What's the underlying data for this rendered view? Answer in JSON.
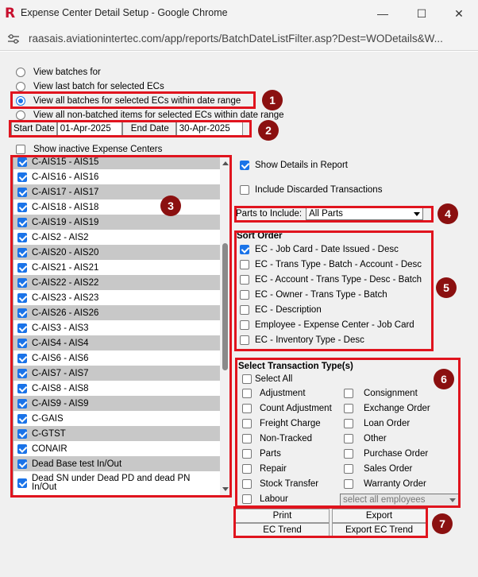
{
  "window": {
    "title": "Expense Center Detail Setup - Google Chrome",
    "url": "raasais.aviationintertec.com/app/reports/BatchDateListFilter.asp?Dest=WODetails&W...",
    "app_icon_letter": "R",
    "minimize_glyph": "—",
    "maximize_glyph": "☐",
    "close_glyph": "✕"
  },
  "batch_options": [
    {
      "label": "View batches for",
      "selected": false
    },
    {
      "label": "View last batch for selected ECs",
      "selected": false
    },
    {
      "label": "View all batches for selected ECs within date range",
      "selected": true
    },
    {
      "label": "View all non-batched items for selected ECs within date range",
      "selected": false
    }
  ],
  "date_range": {
    "start_label": "Start Date",
    "start_value": "01-Apr-2025",
    "end_label": "End Date",
    "end_value": "30-Apr-2025"
  },
  "show_inactive": {
    "label": "Show inactive Expense Centers",
    "checked": false
  },
  "expense_centers": [
    {
      "label": "C-AIS15 - AIS15",
      "checked": true
    },
    {
      "label": "C-AIS16 - AIS16",
      "checked": true
    },
    {
      "label": "C-AIS17 - AIS17",
      "checked": true
    },
    {
      "label": "C-AIS18 - AIS18",
      "checked": true
    },
    {
      "label": "C-AIS19 - AIS19",
      "checked": true
    },
    {
      "label": "C-AIS2 - AIS2",
      "checked": true
    },
    {
      "label": "C-AIS20 - AIS20",
      "checked": true
    },
    {
      "label": "C-AIS21 - AIS21",
      "checked": true
    },
    {
      "label": "C-AIS22 - AIS22",
      "checked": true
    },
    {
      "label": "C-AIS23 - AIS23",
      "checked": true
    },
    {
      "label": "C-AIS26 - AIS26",
      "checked": true
    },
    {
      "label": "C-AIS3 - AIS3",
      "checked": true
    },
    {
      "label": "C-AIS4 - AIS4",
      "checked": true
    },
    {
      "label": "C-AIS6 - AIS6",
      "checked": true
    },
    {
      "label": "C-AIS7 - AIS7",
      "checked": true
    },
    {
      "label": "C-AIS8 - AIS8",
      "checked": true
    },
    {
      "label": "C-AIS9 - AIS9",
      "checked": true
    },
    {
      "label": "C-GAIS",
      "checked": true
    },
    {
      "label": "C-GTST",
      "checked": true
    },
    {
      "label": "CONAIR",
      "checked": true
    },
    {
      "label": "Dead Base test In/Out",
      "checked": true
    },
    {
      "label": "Dead SN under Dead PD and dead PN In/Out",
      "checked": true
    }
  ],
  "options": {
    "show_details": {
      "label": "Show Details in Report",
      "checked": true
    },
    "include_discarded": {
      "label": "Include Discarded Transactions",
      "checked": false
    }
  },
  "parts": {
    "label": "Parts to Include:",
    "value": "All Parts"
  },
  "sort_order": {
    "title": "Sort Order",
    "items": [
      {
        "label": "EC - Job Card - Date Issued - Desc",
        "checked": true
      },
      {
        "label": "EC - Trans Type - Batch - Account - Desc",
        "checked": false
      },
      {
        "label": "EC - Account - Trans Type - Desc - Batch",
        "checked": false
      },
      {
        "label": "EC - Owner - Trans Type - Batch",
        "checked": false
      },
      {
        "label": "EC - Description",
        "checked": false
      },
      {
        "label": "Employee - Expense Center - Job Card",
        "checked": false
      },
      {
        "label": "EC - Inventory Type - Desc",
        "checked": false
      }
    ]
  },
  "transaction_types": {
    "title": "Select Transaction Type(s)",
    "select_all": "Select All",
    "left": [
      "Adjustment",
      "Count Adjustment",
      "Freight Charge",
      "Non-Tracked",
      "Parts",
      "Repair",
      "Stock Transfer",
      "Labour"
    ],
    "right": [
      "Consignment",
      "Exchange Order",
      "Loan Order",
      "Other",
      "Purchase Order",
      "Sales Order",
      "Warranty Order"
    ],
    "employee_select": "select all employees"
  },
  "buttons": {
    "print": "Print",
    "export": "Export",
    "ec_trend": "EC Trend",
    "export_ec_trend": "Export EC Trend"
  },
  "badges": [
    "1",
    "2",
    "3",
    "4",
    "5",
    "6",
    "7"
  ],
  "colors": {
    "accent": "#1a73e8",
    "highlight": "#e0141e",
    "badge": "#8b1010"
  }
}
